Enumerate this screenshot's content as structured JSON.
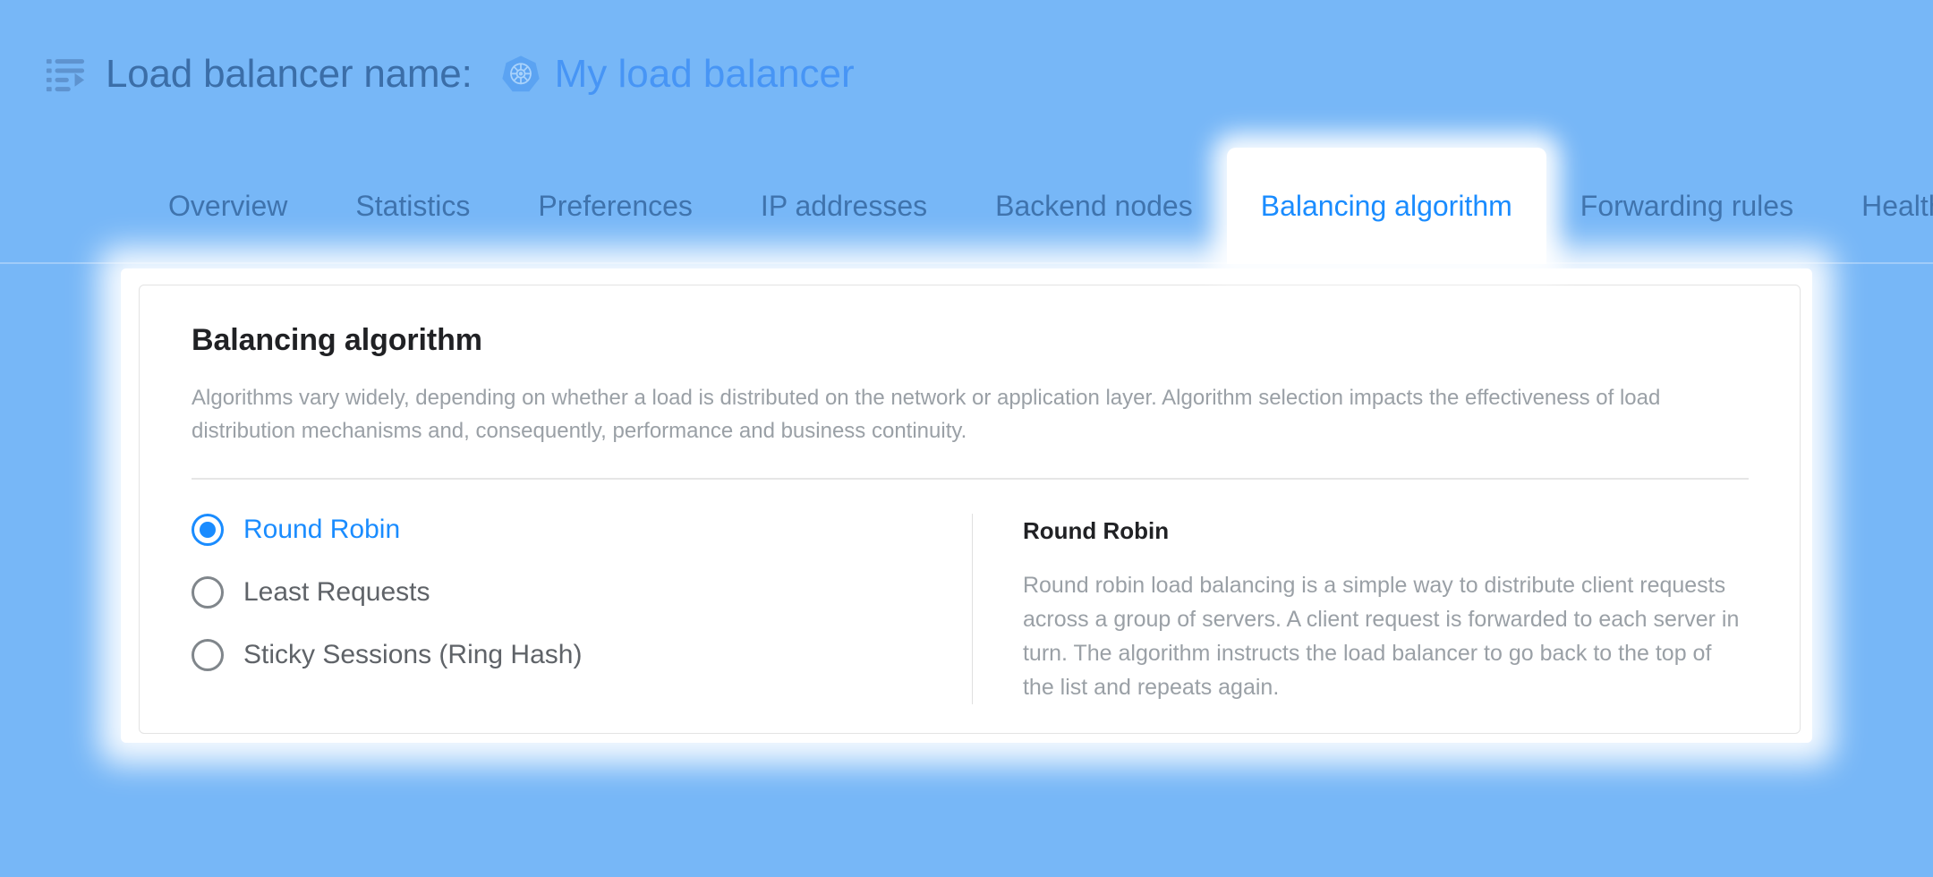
{
  "header": {
    "menu_icon": "list-indent-decrease-icon",
    "title": "Load balancer name:",
    "brand_icon": "kubernetes-icon",
    "load_balancer_name": "My load balancer"
  },
  "tabs": {
    "active": "Balancing algorithm",
    "items": [
      {
        "label": "Overview",
        "active": false
      },
      {
        "label": "Statistics",
        "active": false
      },
      {
        "label": "Preferences",
        "active": false
      },
      {
        "label": "IP addresses",
        "active": false
      },
      {
        "label": "Backend nodes",
        "active": false
      },
      {
        "label": "Balancing algorithm",
        "active": true
      },
      {
        "label": "Forwarding rules",
        "active": false
      },
      {
        "label": "Health",
        "active": false
      }
    ]
  },
  "card": {
    "title": "Balancing algorithm",
    "description": "Algorithms vary widely, depending on whether a load is distributed on the network or application layer. Algorithm selection impacts the effectiveness of load distribution mechanisms and, consequently, performance and business continuity."
  },
  "algorithms": {
    "selected": "Round Robin",
    "options": [
      {
        "label": "Round Robin",
        "selected": true
      },
      {
        "label": "Least Requests",
        "selected": false
      },
      {
        "label": "Sticky Sessions (Ring Hash)",
        "selected": false
      }
    ]
  },
  "detail": {
    "title": "Round Robin",
    "text": "Round robin load balancing is a simple way to distribute client requests across a group of servers. A client request is forwarded to each server in turn. The algorithm instructs the load balancer to go back to the top of the list and repeats again."
  },
  "colors": {
    "page_background": "#77b7f7",
    "accent_blue": "#1a8cff",
    "header_text": "#3b6ea8",
    "tab_inactive": "#3f73ad",
    "card_background": "#ffffff",
    "muted_text": "#9aa0a6"
  }
}
